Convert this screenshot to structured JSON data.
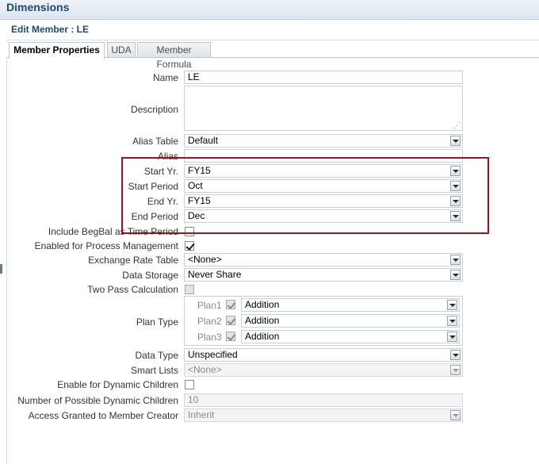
{
  "window": {
    "title": "Dimensions"
  },
  "page": {
    "edit_title": "Edit Member : LE"
  },
  "tabs": [
    {
      "label": "Member Properties",
      "active": true
    },
    {
      "label": "UDA",
      "active": false
    },
    {
      "label": "Member Formula",
      "active": false
    }
  ],
  "form": {
    "name": {
      "label": "Name",
      "value": "LE"
    },
    "description": {
      "label": "Description",
      "value": ""
    },
    "alias_table": {
      "label": "Alias Table",
      "value": "Default"
    },
    "alias": {
      "label": "Alias",
      "value": ""
    },
    "start_yr": {
      "label": "Start Yr.",
      "value": "FY15"
    },
    "start_period": {
      "label": "Start Period",
      "value": "Oct"
    },
    "end_yr": {
      "label": "End Yr.",
      "value": "FY15"
    },
    "end_period": {
      "label": "End Period",
      "value": "Dec"
    },
    "include_begbal": {
      "label": "Include BegBal as Time Period",
      "checked": false
    },
    "process_mgmt": {
      "label": "Enabled for Process Management",
      "checked": true
    },
    "exchange_rate": {
      "label": "Exchange Rate Table",
      "value": "<None>"
    },
    "data_storage": {
      "label": "Data Storage",
      "value": "Never Share"
    },
    "two_pass": {
      "label": "Two Pass Calculation",
      "checked": false
    },
    "plan_type": {
      "label": "Plan Type",
      "plans": [
        {
          "label": "Plan1",
          "checked": true,
          "aggregation": "Addition"
        },
        {
          "label": "Plan2",
          "checked": true,
          "aggregation": "Addition"
        },
        {
          "label": "Plan3",
          "checked": true,
          "aggregation": "Addition"
        }
      ]
    },
    "data_type": {
      "label": "Data Type",
      "value": "Unspecified"
    },
    "smart_lists": {
      "label": "Smart Lists",
      "value": "<None>"
    },
    "dynamic_children": {
      "label": "Enable for Dynamic Children",
      "checked": false
    },
    "num_dynamic_children": {
      "label": "Number of Possible Dynamic Children",
      "value": "10"
    },
    "access_granted": {
      "label": "Access Granted to Member Creator",
      "value": "Inherit"
    }
  },
  "colors": {
    "highlight_border": "#8b1a1a",
    "title_text": "#1f4a6e"
  }
}
